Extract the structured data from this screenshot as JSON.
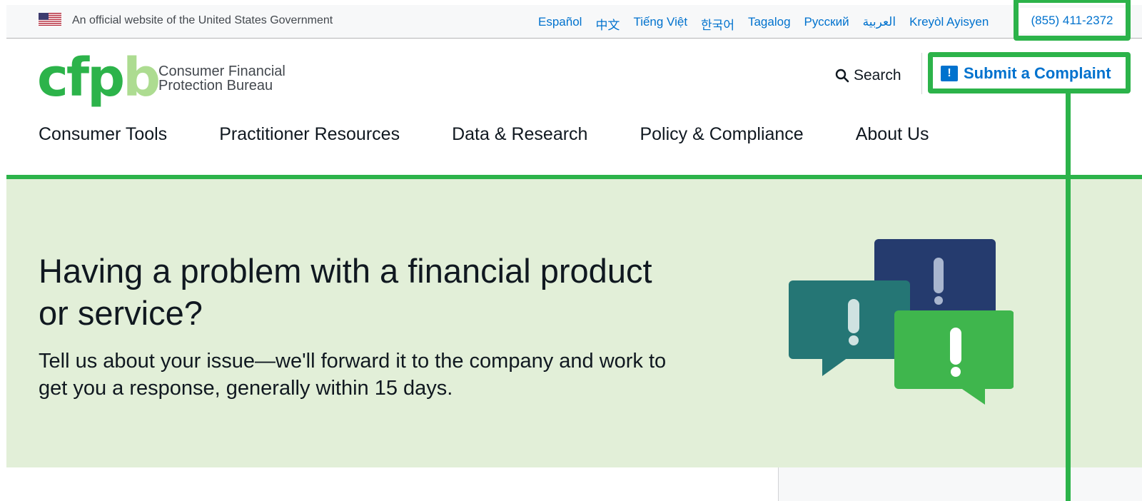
{
  "banner": {
    "official_text": "An official website of the United States Government",
    "languages": [
      "Español",
      "中文",
      "Tiếng Việt",
      "한국어",
      "Tagalog",
      "Русский",
      "العربية",
      "Kreyòl Ayisyen"
    ],
    "phone": "(855) 411-2372"
  },
  "header": {
    "logo_mark": "cfpb",
    "logo_line1": "Consumer Financial",
    "logo_line2": "Protection Bureau",
    "search_label": "Search",
    "complaint_label": "Submit a Complaint"
  },
  "nav": {
    "items": [
      "Consumer Tools",
      "Practitioner Resources",
      "Data & Research",
      "Policy & Compliance",
      "About Us"
    ]
  },
  "hero": {
    "headline": "Having a problem with a financial product or service?",
    "subtext": "Tell us about your issue—we'll forward it to the company and work to get you a response, generally within 15 days."
  },
  "colors": {
    "accent_green": "#2cb34a",
    "link_blue": "#0072ce",
    "hero_bg": "#e2efd8",
    "navy": "#253b6e",
    "teal": "#257675",
    "bright_green": "#3fb64d"
  },
  "icons": {
    "flag": "us-flag-icon",
    "search": "search-icon",
    "complaint": "complaint-bubble-icon",
    "illustration": "speech-bubbles-exclamation-icon"
  }
}
